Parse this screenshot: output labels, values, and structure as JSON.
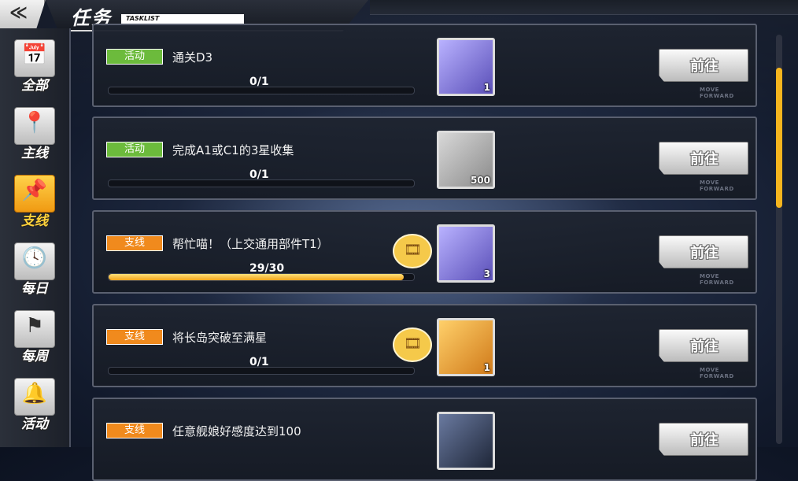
{
  "header": {
    "back_glyph": "≪",
    "title": "任务",
    "subtitle": "TASKLIST"
  },
  "sidebar": {
    "items": [
      {
        "label": "全部",
        "icon": "calendar-star-icon",
        "glyph": "📅",
        "active": false
      },
      {
        "label": "主线",
        "icon": "map-pin-icon",
        "glyph": "📍",
        "active": false
      },
      {
        "label": "支线",
        "icon": "route-pins-icon",
        "glyph": "📌",
        "active": true
      },
      {
        "label": "每日",
        "icon": "history-clock-icon",
        "glyph": "🕓",
        "active": false
      },
      {
        "label": "每周",
        "icon": "flag-icon",
        "glyph": "⚑",
        "active": false
      },
      {
        "label": "活动",
        "icon": "bell-icon",
        "glyph": "🔔",
        "active": false
      }
    ]
  },
  "tasks": [
    {
      "tag": "活动",
      "tag_color": "#6cbb3c",
      "text": "通关D3",
      "progress_text": "0/1",
      "progress": 0.0,
      "reward_icon": "prism-crystal-icon",
      "reward_qty": "1",
      "has_video": false,
      "button": "前往",
      "button_sub": "MOVE FORWARD"
    },
    {
      "tag": "活动",
      "tag_color": "#6cbb3c",
      "text": "完成A1或C1的3星收集",
      "progress_text": "0/1",
      "progress": 0.0,
      "reward_icon": "oil-barrel-icon",
      "reward_qty": "500",
      "has_video": false,
      "button": "前往",
      "button_sub": "MOVE FORWARD"
    },
    {
      "tag": "支线",
      "tag_color": "#f08a1d",
      "text": "帮忙喵！（上交通用部件T1）",
      "progress_text": "29/30",
      "progress": 0.967,
      "reward_icon": "part-book-icon",
      "reward_qty": "3",
      "has_video": true,
      "button": "前往",
      "button_sub": "MOVE FORWARD"
    },
    {
      "tag": "支线",
      "tag_color": "#f08a1d",
      "text": "将长岛突破至满星",
      "progress_text": "0/1",
      "progress": 0.0,
      "reward_icon": "popcorn-cola-icon",
      "reward_qty": "1",
      "has_video": true,
      "button": "前往",
      "button_sub": "MOVE FORWARD"
    },
    {
      "tag": "支线",
      "tag_color": "#f08a1d",
      "text": "任意舰娘好感度达到100",
      "progress_text": "",
      "progress": 0.0,
      "reward_icon": "ring-box-icon",
      "reward_qty": "",
      "has_video": false,
      "button": "前往",
      "button_sub": ""
    }
  ],
  "scrollbar": {
    "accent": "#f6b51e"
  }
}
